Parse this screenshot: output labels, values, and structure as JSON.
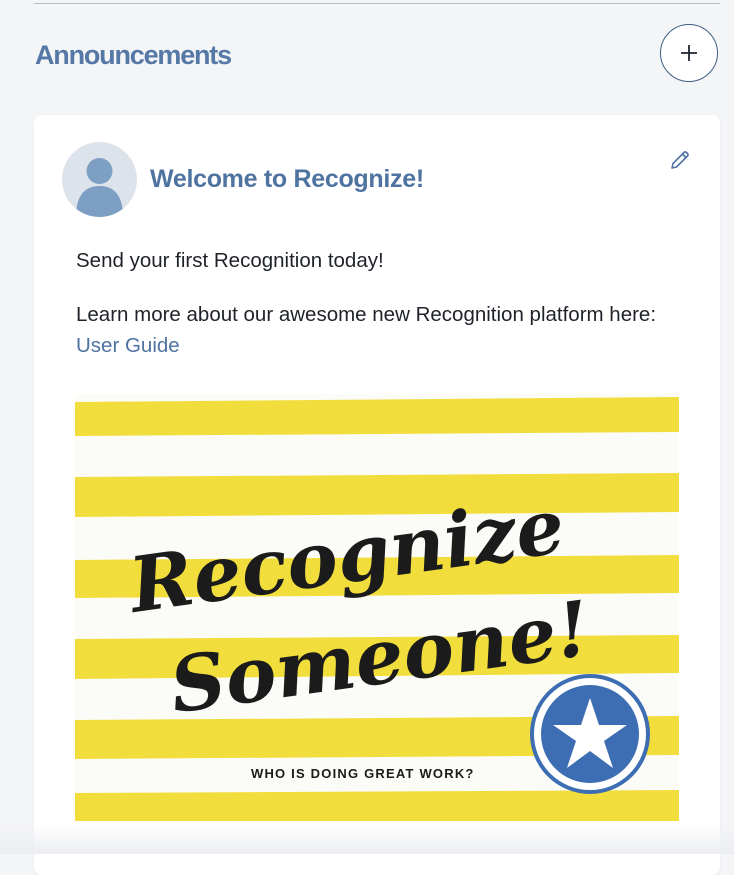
{
  "section": {
    "title": "Announcements"
  },
  "icons": {
    "add": "plus-icon",
    "edit": "pencil-icon",
    "avatar": "user-silhouette-icon",
    "badge": "star-icon"
  },
  "colors": {
    "heading": "#5578a6",
    "link": "#4f73a1",
    "banner_yellow": "#f1de3c",
    "badge_blue": "#3d6db3"
  },
  "announcement": {
    "title": "Welcome to Recognize!",
    "paragraph1": "Send your first Recognition today!",
    "paragraph2_prefix": "Learn more about our awesome new Recognition platform here:",
    "link_label": "User Guide",
    "banner": {
      "line1": "Recognize",
      "line2": "Someone!",
      "tagline": "WHO IS DOING GREAT WORK?"
    }
  }
}
